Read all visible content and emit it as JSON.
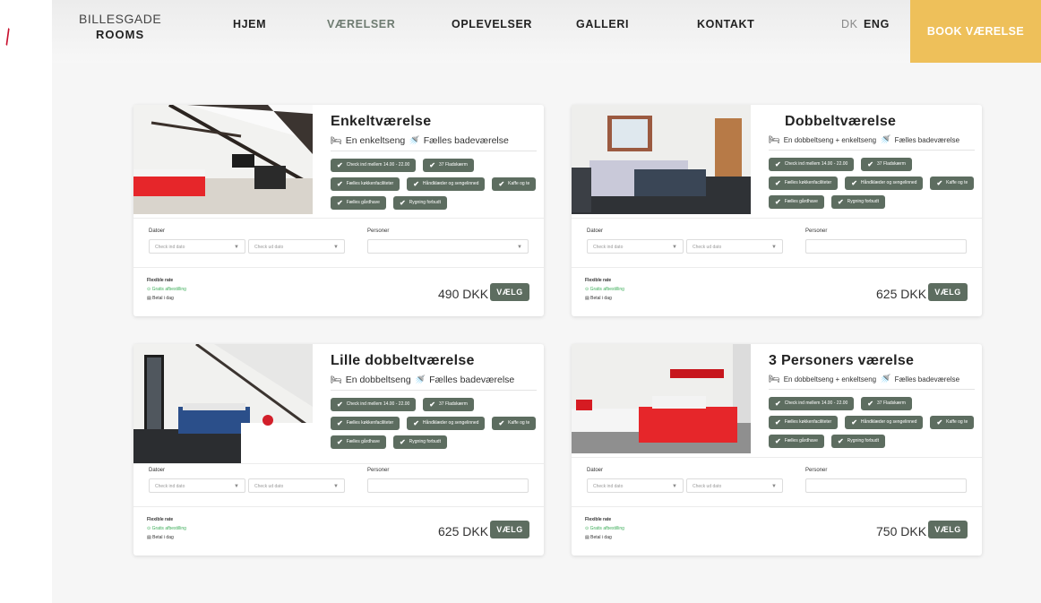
{
  "header": {
    "logo_line1": "BILLESGADE",
    "logo_line2": "ROOMS",
    "nav": [
      "HJEM",
      "VÆRELSER",
      "OPLEVELSER",
      "GALLERI",
      "KONTAKT"
    ],
    "lang_dk": "DK",
    "lang_eng": "ENG",
    "book_label": "BOOK VÆRELSE",
    "accent": "#eec05a",
    "active_nav": "#6e7b71"
  },
  "common": {
    "chips": [
      "Check ind mellem 14.00 - 22.00",
      "37 Fladskærm",
      "Fælles køkkenfaciliteter",
      "Håndklæder og sengelinned",
      "Kaffe og te",
      "Fælles gårdhave",
      "Rygning forbudt"
    ],
    "dates_label": "Datoer",
    "checkin_placeholder": "Check ind dato",
    "checkout_placeholder": "Check ud dato",
    "persons_label": "Personer",
    "free_cancel": "Gratis afbestilling",
    "pay_today": "Betal i dag",
    "velg": "VÆLG",
    "chip_color": "#5d6d60",
    "bed_icon": "bed-icon",
    "shower_icon": "shower-icon"
  },
  "rooms": [
    {
      "title": "Enkeltværelse",
      "bed": "En enkeltseng",
      "bath": "Fælles badeværelse",
      "rate": "Flexible rate",
      "price": "490 DKK"
    },
    {
      "title": "Dobbeltværelse",
      "bed": "En dobbeltseng + enkeltseng",
      "bath": "Fælles badeværelse",
      "rate": "Flexible rate",
      "price": "625 DKK"
    },
    {
      "title": "Lille dobbeltværelse",
      "bed": "En dobbeltseng",
      "bath": "Fælles badeværelse",
      "rate": "Flexible rate",
      "price": "625 DKK"
    },
    {
      "title": "3 Personers værelse",
      "bed": "En dobbeltseng + enkeltseng",
      "bath": "Fælles badeværelse",
      "rate": "Flexible rate",
      "price": "750 DKK"
    }
  ]
}
